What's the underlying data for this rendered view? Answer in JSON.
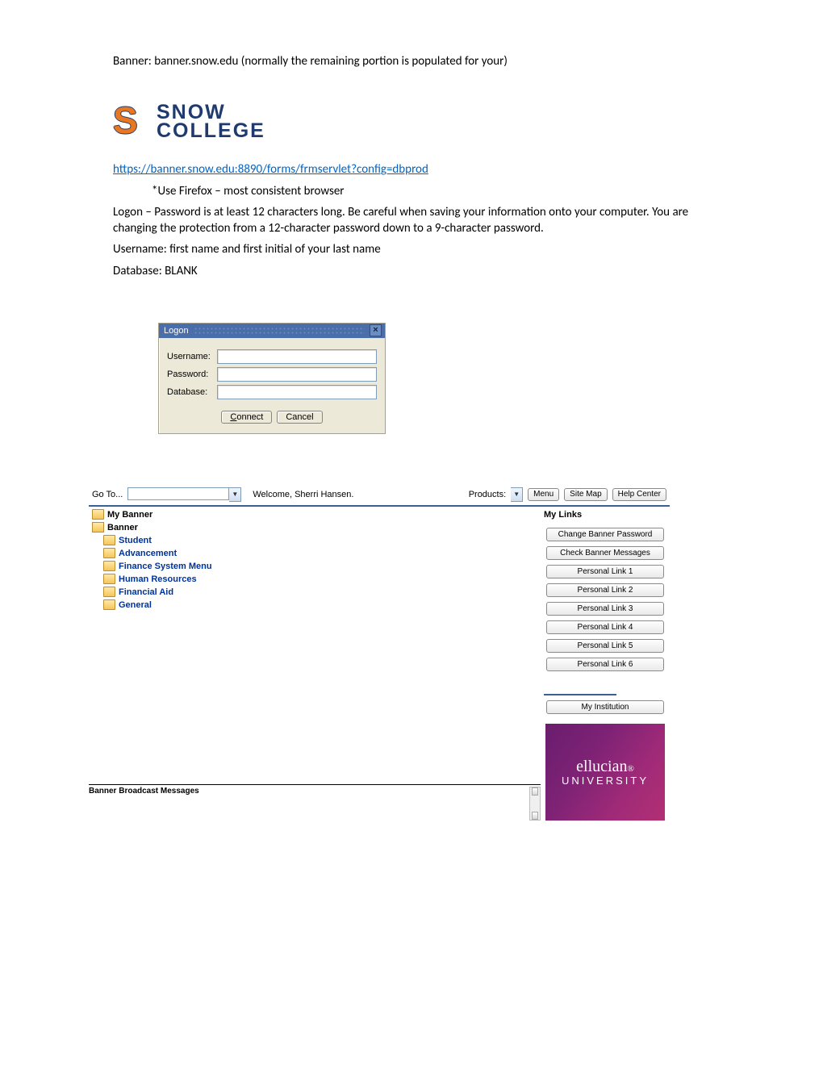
{
  "doc": {
    "line1": "Banner: banner.snow.edu (normally the remaining portion is populated for your)",
    "logo_word1": "SNOW",
    "logo_word2": "COLLEGE",
    "logo_s": "S",
    "url": "https://banner.snow.edu:8890/forms/frmservlet?config=dbprod",
    "firefox_note": "*Use Firefox – most consistent browser",
    "logon_note": "Logon – Password is at least 12 characters long.  Be careful when saving your information onto your computer.  You are changing the protection from a 12-character password down to a 9-character password.",
    "username_note": "Username: first name and first initial of your last name",
    "database_note": "Database: BLANK"
  },
  "logon": {
    "title": "Logon",
    "close_glyph": "×",
    "username_label": "Username:",
    "password_label": "Password:",
    "database_label": "Database:",
    "username_value": "",
    "password_value": "",
    "database_value": "",
    "connect_access": "C",
    "connect_rest": "onnect",
    "cancel_label": "Cancel"
  },
  "banner": {
    "goto_label": "Go To...",
    "goto_value": "",
    "welcome": "Welcome, Sherri Hansen.",
    "products_label": "Products:",
    "top_buttons": [
      "Menu",
      "Site Map",
      "Help Center"
    ],
    "tree": {
      "my_banner": "My Banner",
      "banner": "Banner",
      "items": [
        "Student",
        "Advancement",
        "Finance System Menu",
        "Human Resources",
        "Financial Aid",
        "General"
      ]
    },
    "mylinks_header": "My Links",
    "links": [
      "Change Banner Password",
      "Check Banner Messages",
      "Personal Link 1",
      "Personal Link 2",
      "Personal Link 3",
      "Personal Link 4",
      "Personal Link 5",
      "Personal Link 6"
    ],
    "my_institution_label": "My Institution",
    "ellucian_brand": "ellucian",
    "ellucian_dot": "®",
    "ellucian_sub": "UNIVERSITY",
    "broadcast_label": "Banner Broadcast Messages"
  }
}
